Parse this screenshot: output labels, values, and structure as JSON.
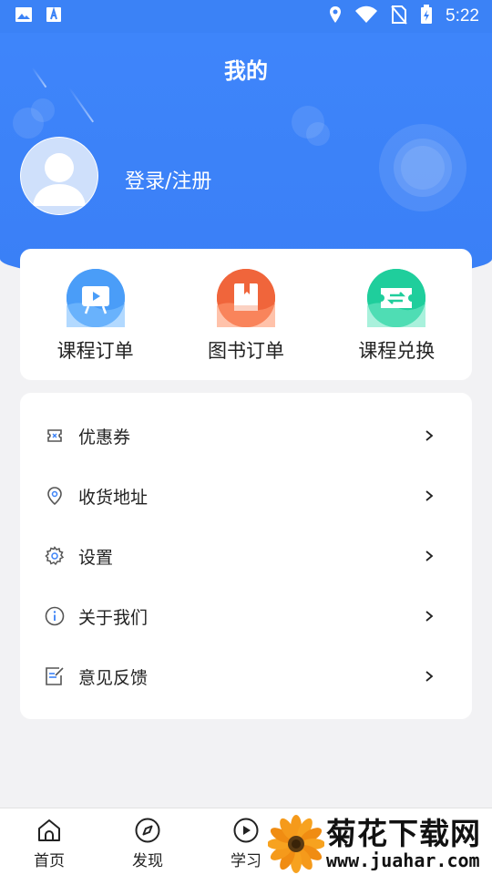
{
  "status_bar": {
    "time": "5:22"
  },
  "header": {
    "title": "我的",
    "login_label": "登录/注册"
  },
  "orders": [
    {
      "label": "课程订单",
      "icon": "course-order-icon",
      "color": "#4a9df8"
    },
    {
      "label": "图书订单",
      "icon": "book-order-icon",
      "color": "#f0653b"
    },
    {
      "label": "课程兑换",
      "icon": "course-exchange-icon",
      "color": "#1fce9c"
    }
  ],
  "menu": [
    {
      "label": "优惠券",
      "icon": "coupon-icon"
    },
    {
      "label": "收货地址",
      "icon": "location-icon"
    },
    {
      "label": "设置",
      "icon": "gear-icon"
    },
    {
      "label": "关于我们",
      "icon": "info-icon"
    },
    {
      "label": "意见反馈",
      "icon": "feedback-icon"
    }
  ],
  "bottom_nav": [
    {
      "label": "首页",
      "icon": "home-icon"
    },
    {
      "label": "发现",
      "icon": "compass-icon"
    },
    {
      "label": "学习",
      "icon": "play-icon"
    }
  ],
  "watermark": {
    "title": "菊花下载网",
    "url": "www.juahar.com"
  },
  "colors": {
    "primary": "#3b82f6",
    "background": "#f2f2f4"
  }
}
